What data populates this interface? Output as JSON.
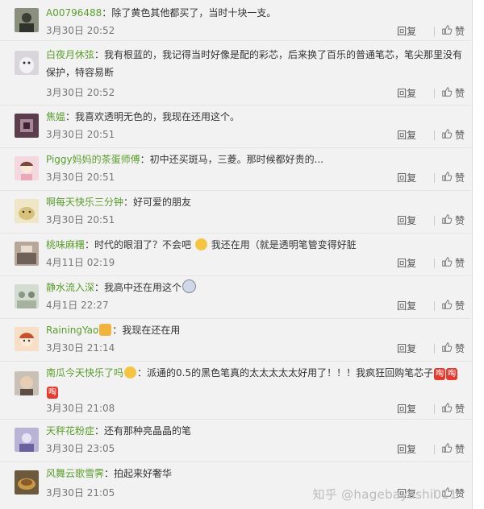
{
  "ui": {
    "reply_label": "回复",
    "like_label": "赞"
  },
  "comments": [
    {
      "user": "A00796488",
      "text": "除了黄色其他都买了，当时十块一支。",
      "time": "3月30日 20:52"
    },
    {
      "user": "白夜月休弦",
      "text": "我有根蓝的，我记得当时好像是配的彩芯，后来换了百乐的普通笔芯，笔尖那里没有保护，特容易断",
      "time": "3月30日 20:52"
    },
    {
      "user": "焦媪",
      "text": "我喜欢透明无色的，我现在还用这个。",
      "time": "3月30日 20:51"
    },
    {
      "user": "Piggy妈妈的茶蛋师傅",
      "text": "初中还买斑马，三菱。那时候都好贵的...",
      "time": "3月30日 20:51"
    },
    {
      "user": "啊每天快乐三分钟",
      "text": "好可爱的朋友",
      "time": "3月30日 20:51"
    },
    {
      "user": "桃味麻糬",
      "text": "时代的眼泪了？不会吧",
      "text2": "我还在用（就是透明笔管变得好脏",
      "time": "4月11日 02:19"
    },
    {
      "user": "静水流入深",
      "text": "我高中还在用这个",
      "time": "4月1日 22:27"
    },
    {
      "user": "RainingYao",
      "text": "我现在还在用",
      "time": "3月30日 21:14"
    },
    {
      "user": "南瓜今天快乐了吗",
      "text": "派通的0.5的黑色笔真的太太太太太好用了！！！我疯狂回购笔芯子",
      "stamp": "啕",
      "time": "3月30日 21:08"
    },
    {
      "user": "天秤花粉症",
      "text": "还有那种亮晶晶的笔",
      "time": "3月30日 23:05"
    },
    {
      "user": "风舞云歌雪霁",
      "text": "拍起来好奢华",
      "time": "3月30日 21:05"
    }
  ],
  "watermark": "知乎 @hagebayashi011",
  "colors": {
    "username": "#5a9e2c",
    "background": "#f2f2f2",
    "stamp": "#e53b2e"
  },
  "avatar_icons": [
    "avatar-portrait-icon",
    "avatar-cat-icon",
    "avatar-pattern-icon",
    "avatar-girl-icon",
    "avatar-pet-icon",
    "avatar-room-icon",
    "avatar-group-icon",
    "avatar-cartoon-icon",
    "avatar-face-icon",
    "avatar-purple-icon",
    "avatar-food-icon"
  ]
}
